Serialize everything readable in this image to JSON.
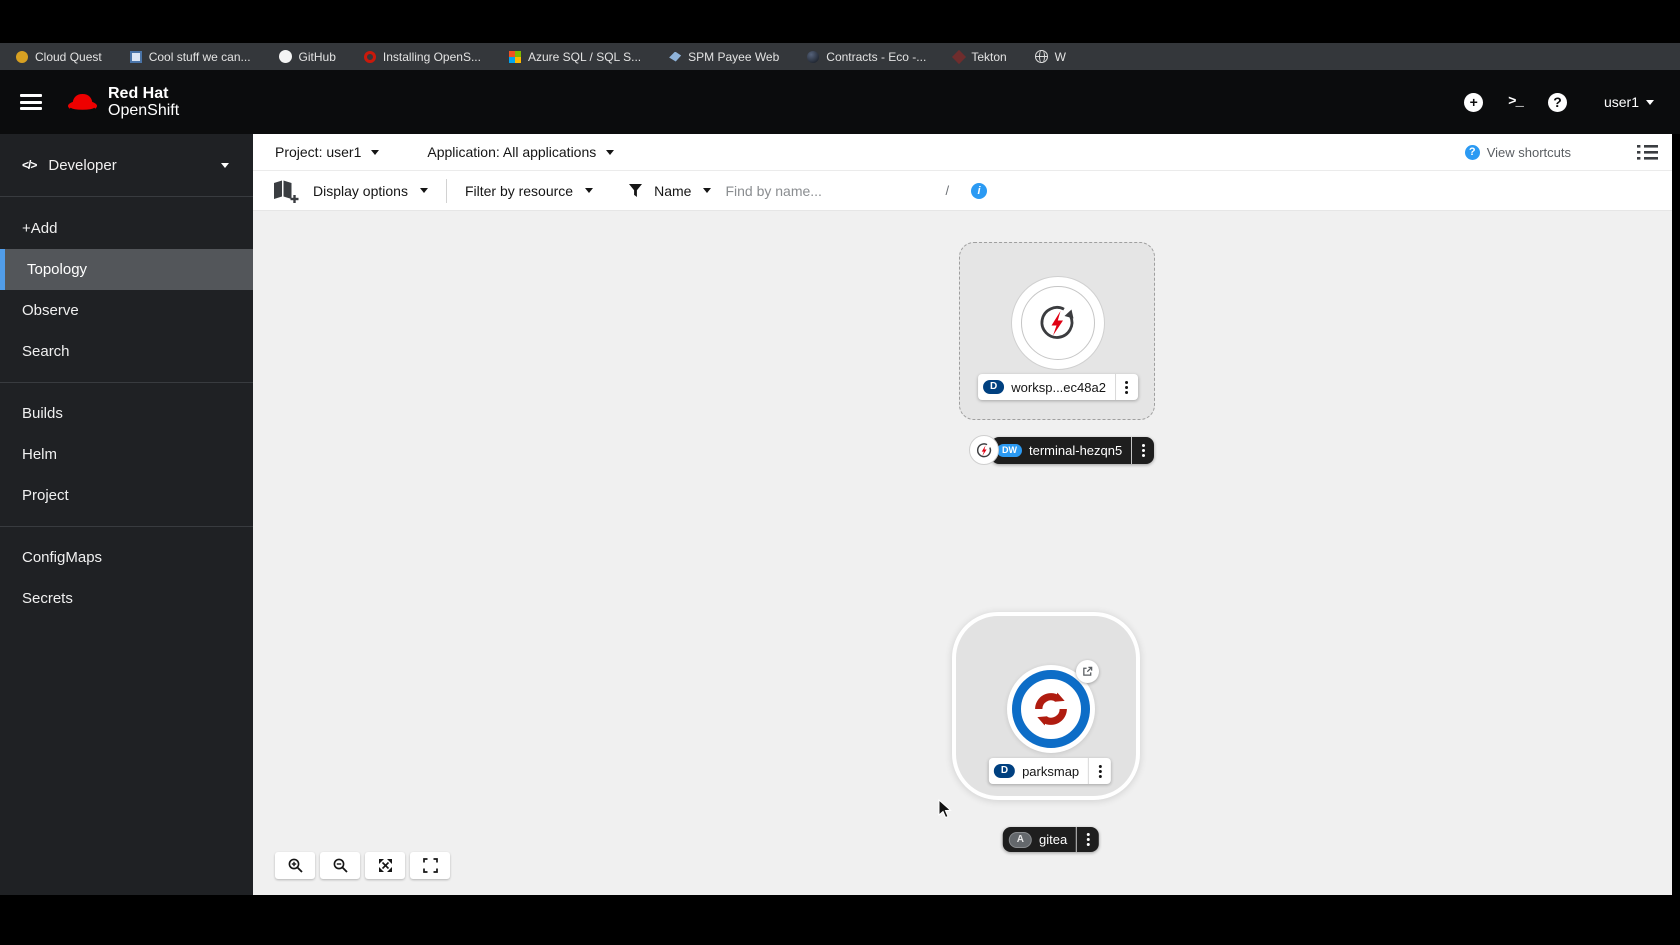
{
  "browser": {
    "bookmarks": [
      {
        "label": "Cloud Quest"
      },
      {
        "label": "Cool stuff we can..."
      },
      {
        "label": "GitHub"
      },
      {
        "label": "Installing OpenS..."
      },
      {
        "label": "Azure SQL / SQL S..."
      },
      {
        "label": "SPM Payee Web"
      },
      {
        "label": "Contracts - Eco -..."
      },
      {
        "label": "Tekton"
      },
      {
        "label": "W"
      }
    ]
  },
  "header": {
    "brand_line1": "Red Hat",
    "brand_line2": "OpenShift",
    "user": "user1"
  },
  "sidebar": {
    "perspective": "Developer",
    "items": [
      {
        "label": "+Add"
      },
      {
        "label": "Topology"
      },
      {
        "label": "Observe"
      },
      {
        "label": "Search"
      },
      {
        "label": "Builds"
      },
      {
        "label": "Helm"
      },
      {
        "label": "Project"
      },
      {
        "label": "ConfigMaps"
      },
      {
        "label": "Secrets"
      }
    ]
  },
  "context_bar": {
    "project": "Project: user1",
    "application": "Application: All applications",
    "view_shortcuts": "View shortcuts"
  },
  "toolbar": {
    "display_options": "Display options",
    "filter_by_resource": "Filter by resource",
    "name_filter": "Name",
    "search_placeholder": "Find by name...",
    "shortcut_hint": "/"
  },
  "topology": {
    "workspace": {
      "badge": "D",
      "label": "worksp...ec48a2"
    },
    "terminal": {
      "badge": "DW",
      "label": "terminal-hezqn5"
    },
    "parksmap": {
      "badge": "D",
      "label": "parksmap"
    },
    "gitea": {
      "badge": "A",
      "label": "gitea"
    }
  },
  "colors": {
    "accent_blue": "#2b9af3",
    "badge_deployment": "#004080",
    "badge_devworkspace": "#2b9af3",
    "openshift_red": "#ee0000",
    "nav_selected_bar": "#519de9",
    "parksmap_ring": "#0d6dc7"
  }
}
